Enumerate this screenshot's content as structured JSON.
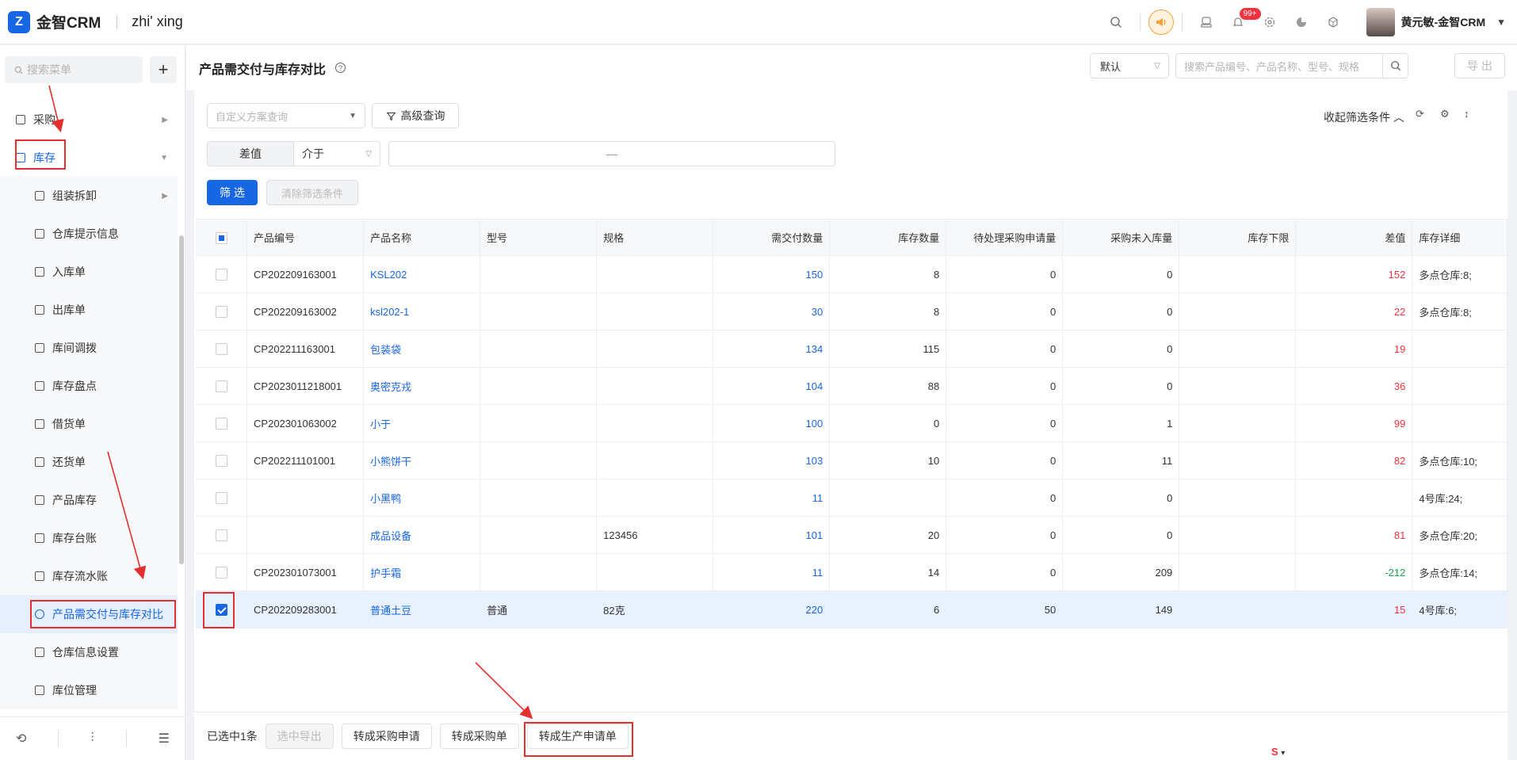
{
  "app": {
    "brand": "金智CRM",
    "org": "zhi' xing",
    "username": "黄元敏-金智CRM",
    "notice_badge": "99+",
    "logo_letter": "Z"
  },
  "sidebar": {
    "search_placeholder": "搜索菜单",
    "plus": "+",
    "items": [
      {
        "label": "采购"
      },
      {
        "label": "库存"
      },
      {
        "label": "组装拆卸"
      },
      {
        "label": "仓库提示信息"
      },
      {
        "label": "入库单"
      },
      {
        "label": "出库单"
      },
      {
        "label": "库间调拨"
      },
      {
        "label": "库存盘点"
      },
      {
        "label": "借货单"
      },
      {
        "label": "还货单"
      },
      {
        "label": "产品库存"
      },
      {
        "label": "库存台账"
      },
      {
        "label": "库存流水账"
      },
      {
        "label": "产品需交付与库存对比"
      },
      {
        "label": "仓库信息设置"
      },
      {
        "label": "库位管理"
      }
    ]
  },
  "header": {
    "title": "产品需交付与库存对比",
    "view_select": "默认",
    "search_placeholder": "搜索产品编号、产品名称、型号、规格",
    "export_label": "导 出"
  },
  "filters": {
    "scheme_placeholder": "自定义方案查询",
    "advanced_label": "高级查询",
    "collapse_label": "收起筛选条件",
    "field_label": "差值",
    "operator": "介于",
    "range_sep": "—",
    "submit_label": "筛 选",
    "clear_label": "清除筛选条件"
  },
  "table": {
    "columns": [
      "产品编号",
      "产品名称",
      "型号",
      "规格",
      "需交付数量",
      "库存数量",
      "待处理采购申请量",
      "采购未入库量",
      "库存下限",
      "差值",
      "库存详细"
    ],
    "rows": [
      {
        "code": "CP202209163001",
        "name": "KSL202",
        "model": "",
        "spec": "",
        "deliver": "150",
        "stock": "8",
        "pending": "0",
        "unreceived": "0",
        "min": "",
        "diff": "152",
        "diff_color": "red",
        "detail": "多点仓库:8;",
        "checked": false
      },
      {
        "code": "CP202209163002",
        "name": "ksl202-1",
        "model": "",
        "spec": "",
        "deliver": "30",
        "stock": "8",
        "pending": "0",
        "unreceived": "0",
        "min": "",
        "diff": "22",
        "diff_color": "red",
        "detail": "多点仓库:8;",
        "checked": false
      },
      {
        "code": "CP202211163001",
        "name": "包装袋",
        "model": "",
        "spec": "",
        "deliver": "134",
        "stock": "115",
        "pending": "0",
        "unreceived": "0",
        "min": "",
        "diff": "19",
        "diff_color": "red",
        "detail": "",
        "checked": false
      },
      {
        "code": "CP2023011218001",
        "name": "奥密克戎",
        "model": "",
        "spec": "",
        "deliver": "104",
        "stock": "88",
        "pending": "0",
        "unreceived": "0",
        "min": "",
        "diff": "36",
        "diff_color": "red",
        "detail": "",
        "checked": false
      },
      {
        "code": "CP202301063002",
        "name": "小于",
        "model": "",
        "spec": "",
        "deliver": "100",
        "stock": "0",
        "pending": "0",
        "unreceived": "1",
        "min": "",
        "diff": "99",
        "diff_color": "red",
        "detail": "",
        "checked": false
      },
      {
        "code": "CP202211101001",
        "name": "小熊饼干",
        "model": "",
        "spec": "",
        "deliver": "103",
        "stock": "10",
        "pending": "0",
        "unreceived": "11",
        "min": "",
        "diff": "82",
        "diff_color": "red",
        "detail": "多点仓库:10;",
        "checked": false
      },
      {
        "code": "",
        "name": "小黑鸭",
        "model": "",
        "spec": "",
        "deliver": "11",
        "stock": "",
        "pending": "0",
        "unreceived": "0",
        "min": "",
        "diff": "",
        "diff_color": "red",
        "detail": "4号库:24;",
        "checked": false
      },
      {
        "code": "",
        "name": "成品设备",
        "model": "",
        "spec": "123456",
        "deliver": "101",
        "stock": "20",
        "pending": "0",
        "unreceived": "0",
        "min": "",
        "diff": "81",
        "diff_color": "red",
        "detail": "多点仓库:20;",
        "checked": false
      },
      {
        "code": "CP202301073001",
        "name": "护手霜",
        "model": "",
        "spec": "",
        "deliver": "11",
        "stock": "14",
        "pending": "0",
        "unreceived": "209",
        "min": "",
        "diff": "-212",
        "diff_color": "green",
        "detail": "多点仓库:14;",
        "checked": false
      },
      {
        "code": "CP202209283001",
        "name": "普通土豆",
        "model": "普通",
        "spec": "82克",
        "deliver": "220",
        "stock": "6",
        "pending": "50",
        "unreceived": "149",
        "min": "",
        "diff": "15",
        "diff_color": "red",
        "detail": "4号库:6;",
        "checked": true
      }
    ]
  },
  "footer": {
    "selected_text": "已选中1条",
    "export_selected": "选中导出",
    "to_purchase_request": "转成采购申请",
    "to_purchase_order": "转成采购单",
    "to_production_request": "转成生产申请单"
  },
  "colors": {
    "primary": "#1766e3",
    "danger": "#f5313d",
    "success": "#17a34a",
    "annotation": "#e52f2f"
  }
}
